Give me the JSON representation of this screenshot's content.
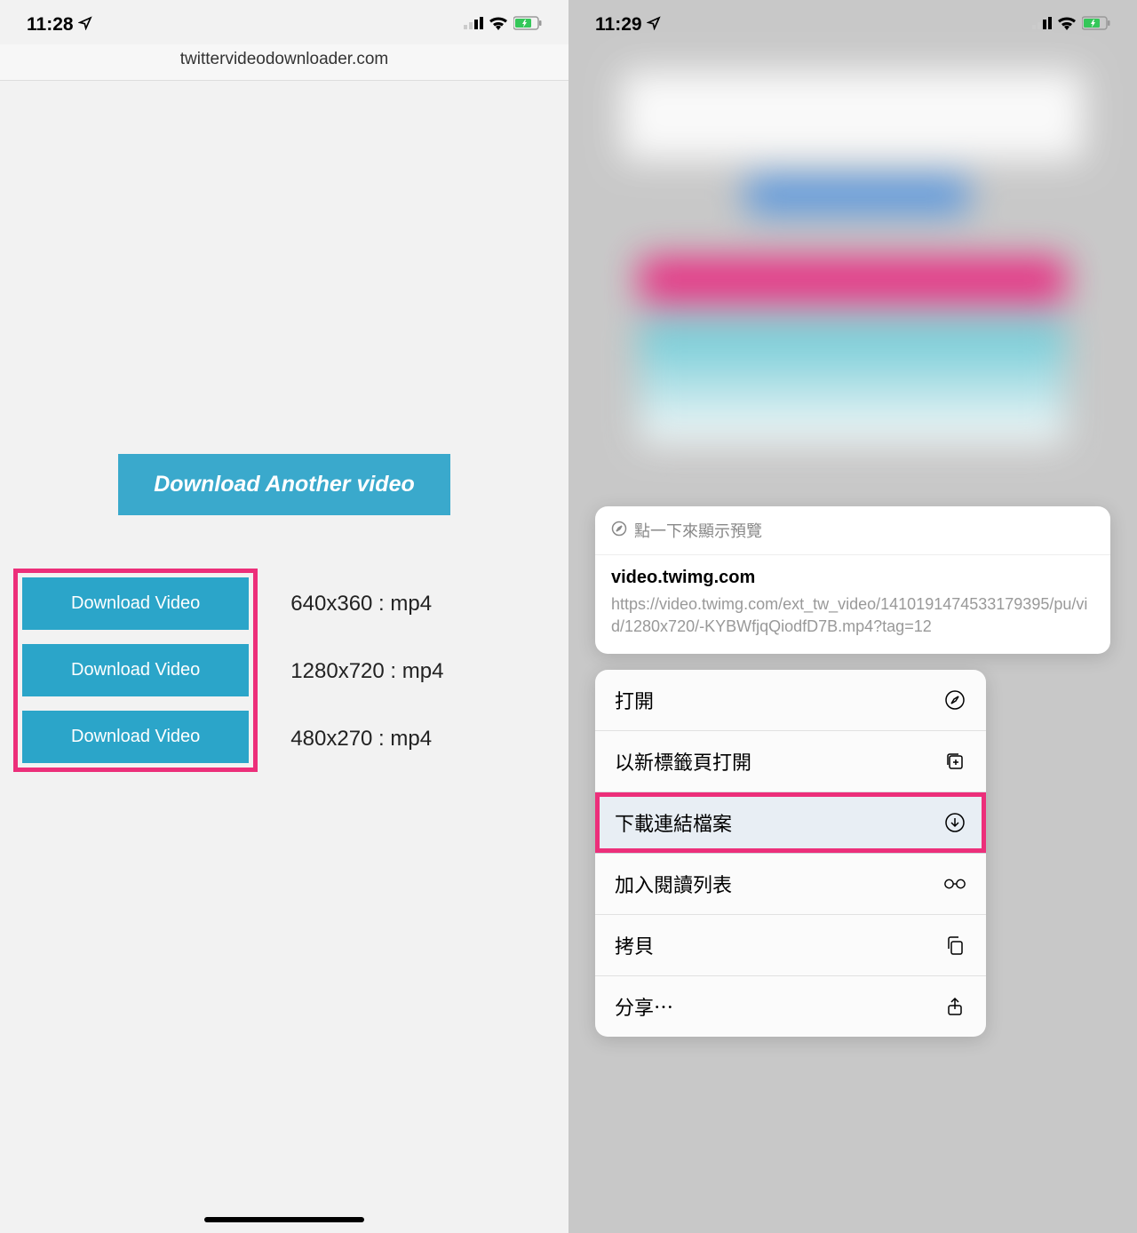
{
  "left": {
    "status": {
      "time": "11:28"
    },
    "url": "twittervideodownloader.com",
    "downloadAnother": "Download Another video",
    "rows": [
      {
        "btn": "Download Video",
        "label": "640x360 : mp4"
      },
      {
        "btn": "Download Video",
        "label": "1280x720 : mp4"
      },
      {
        "btn": "Download Video",
        "label": "480x270 : mp4"
      }
    ]
  },
  "right": {
    "status": {
      "time": "11:29"
    },
    "preview": {
      "hint": "點一下來顯示預覽",
      "domain": "video.twimg.com",
      "url": "https://video.twimg.com/ext_tw_video/1410191474533179395/pu/vid/1280x720/-KYBWfjqQiodfD7B.mp4?tag=12"
    },
    "menu": {
      "open": "打開",
      "openNewTab": "以新標籤頁打開",
      "downloadLink": "下載連結檔案",
      "readingList": "加入閱讀列表",
      "copy": "拷貝",
      "share": "分享⋯"
    }
  }
}
